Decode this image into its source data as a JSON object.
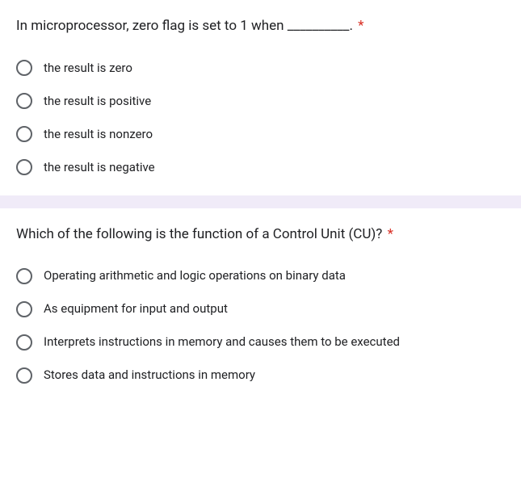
{
  "questions": [
    {
      "title": "In microprocessor, zero flag is set to 1 when __________.",
      "required": "*",
      "options": [
        "the result is zero",
        "the result is positive",
        "the result is nonzero",
        "the result is negative"
      ]
    },
    {
      "title": "Which of the following is the function of a Control Unit (CU)?",
      "required": "*",
      "options": [
        "Operating arithmetic and logic operations on binary data",
        "As equipment for input and output",
        "Interprets instructions in memory and causes them to be executed",
        "Stores data and instructions in memory"
      ]
    }
  ]
}
